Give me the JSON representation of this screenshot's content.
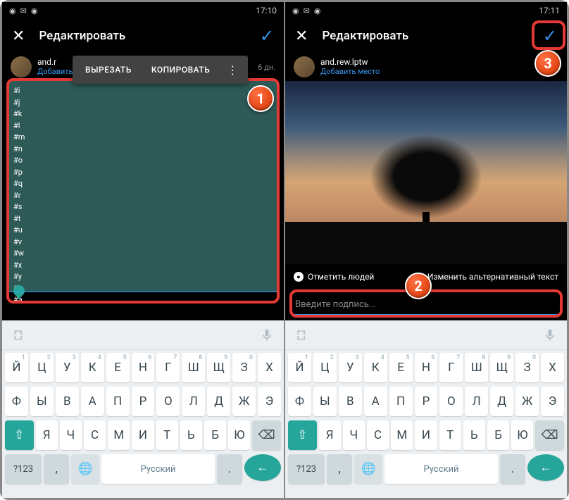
{
  "status": {
    "time_left": "17:10",
    "time_right": "17:11"
  },
  "header": {
    "title": "Редактировать"
  },
  "user": {
    "name_short": "and.r",
    "name_full": "and.rew.lptw",
    "add_place": "Добавить место",
    "age": "6 дн."
  },
  "context_menu": {
    "cut": "ВЫРЕЗАТЬ",
    "copy": "КОПИРОВАТЬ"
  },
  "tags": [
    "#i",
    "#j",
    "#k",
    "#l",
    "#m",
    "#n",
    "#o",
    "#p",
    "#q",
    "#r",
    "#s",
    "#t",
    "#u",
    "#v",
    "#w",
    "#x",
    "#y",
    "#z",
    "#a"
  ],
  "photo_actions": {
    "tag_people": "Отметить людей",
    "alt_text": "Изменить альтернативный текст"
  },
  "caption": {
    "placeholder": "Введите подпись..."
  },
  "badges": {
    "b1": "1",
    "b2": "2",
    "b3": "3"
  },
  "keyboard": {
    "row1": [
      [
        "Й",
        "1"
      ],
      [
        "Ц",
        "2"
      ],
      [
        "У",
        "3"
      ],
      [
        "К",
        "4"
      ],
      [
        "Е",
        "5"
      ],
      [
        "Н",
        "6"
      ],
      [
        "Г",
        "7"
      ],
      [
        "Ш",
        "8"
      ],
      [
        "Щ",
        "9"
      ],
      [
        "З",
        "0"
      ],
      [
        "Х",
        ""
      ]
    ],
    "row2": [
      "Ф",
      "Ы",
      "В",
      "А",
      "П",
      "Р",
      "О",
      "Л",
      "Д",
      "Ж",
      "Э"
    ],
    "row3": [
      "Я",
      "Ч",
      "С",
      "М",
      "И",
      "Т",
      "Ь",
      "Б",
      "Ю"
    ],
    "space_label": "Русский",
    "sym": "?123"
  }
}
